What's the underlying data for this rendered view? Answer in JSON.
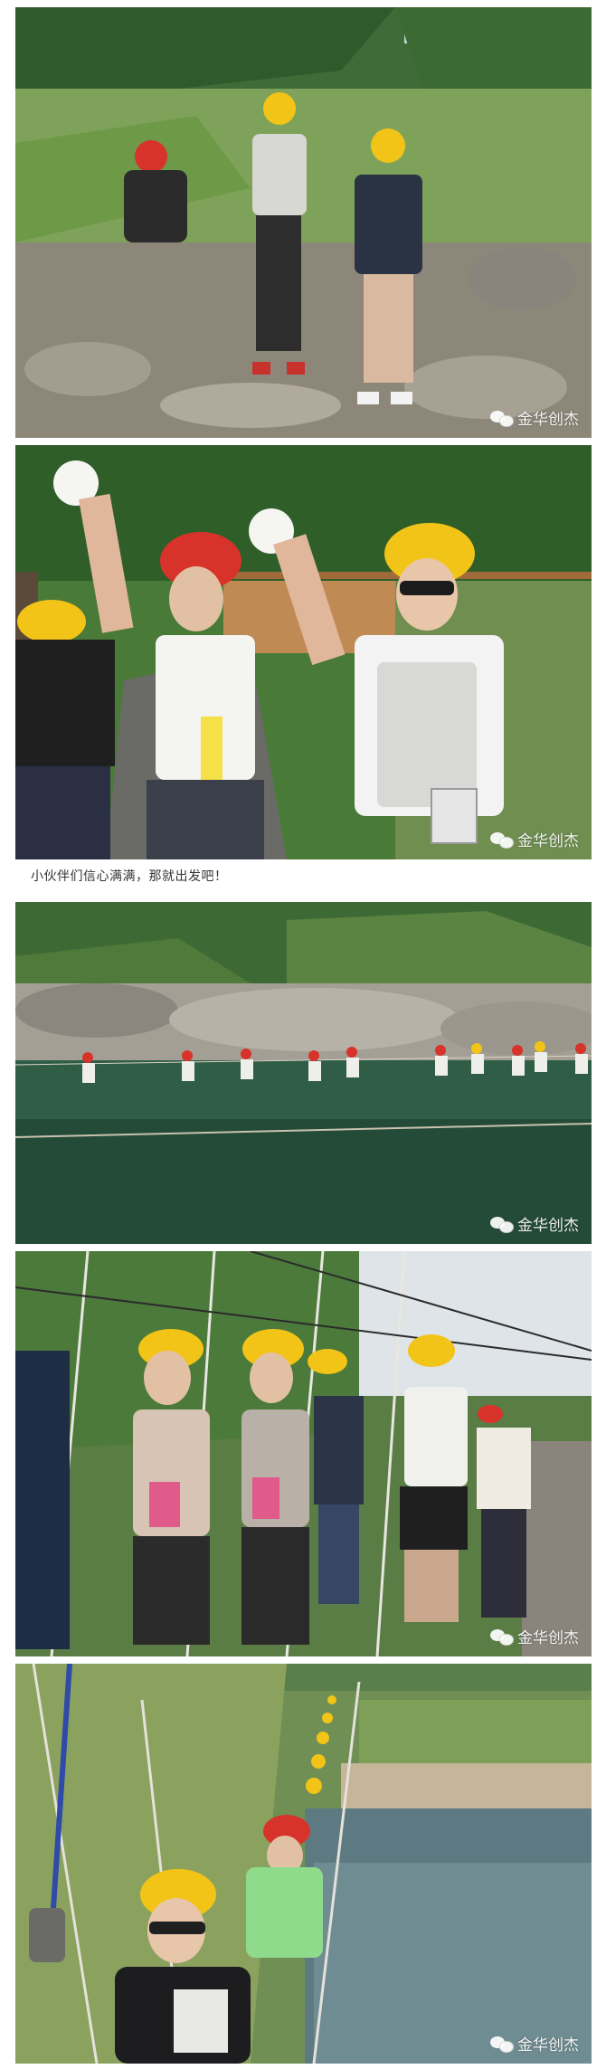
{
  "article": {
    "caption": "小伙伴们信心满满，那就出发吧！",
    "watermark_text": "金华创杰",
    "watermark_icon": "wechat-icon"
  },
  "colors": {
    "helmet_yellow": "#f2c417",
    "helmet_red": "#d8332a",
    "foliage": "#4f7a3a",
    "water": "#2f5a44",
    "rock": "#9a9488"
  },
  "photos": [
    {
      "id": "group-pose-rocks"
    },
    {
      "id": "two-women-waving"
    },
    {
      "id": "river-rope-crossing"
    },
    {
      "id": "wire-bridge-group"
    },
    {
      "id": "suspension-bridge-line"
    }
  ]
}
